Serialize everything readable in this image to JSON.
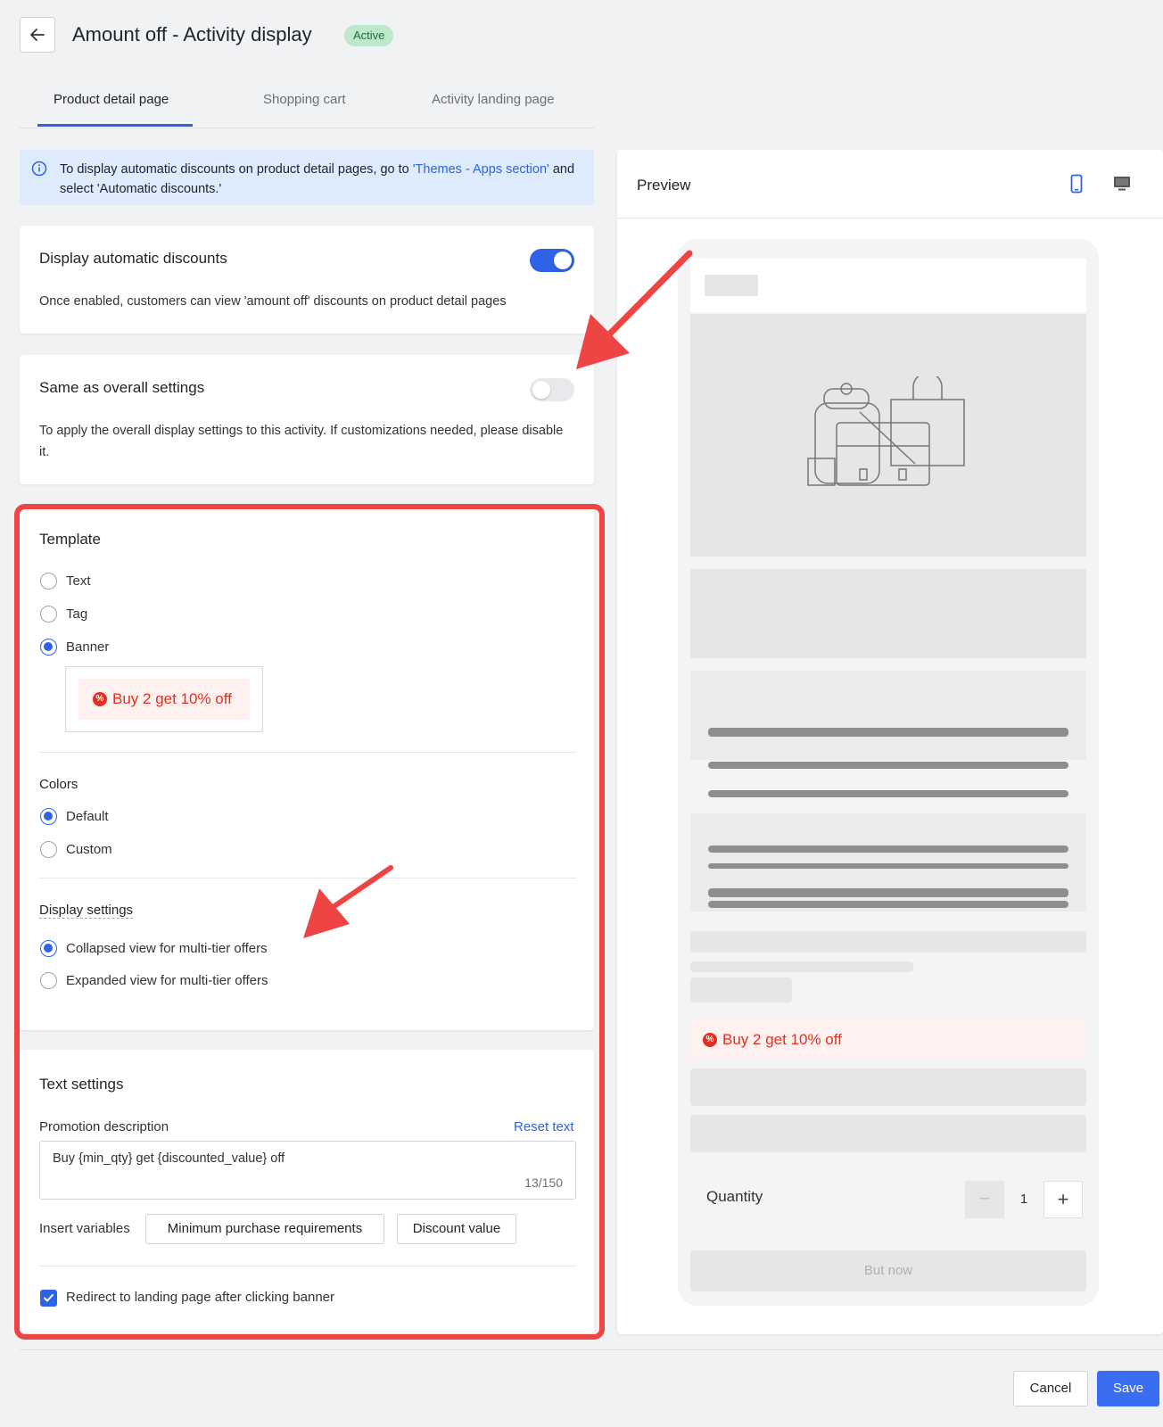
{
  "header": {
    "title": "Amount off - Activity display",
    "status": "Active"
  },
  "tabs": [
    {
      "label": "Product detail page",
      "active": true
    },
    {
      "label": "Shopping cart",
      "active": false
    },
    {
      "label": "Activity landing page",
      "active": false
    }
  ],
  "info_banner": {
    "text_before": "To display automatic discounts on product detail pages, go to ",
    "link_text": "'Themes - Apps section'",
    "text_after": " and select 'Automatic discounts.'"
  },
  "display_automatic": {
    "title": "Display automatic discounts",
    "description": "Once enabled, customers can view 'amount off' discounts on product detail pages",
    "enabled": true
  },
  "same_as_overall": {
    "title": "Same as overall settings",
    "description": "To apply the overall display settings to this activity. If customizations needed, please disable it.",
    "enabled": false
  },
  "template": {
    "title": "Template",
    "options": [
      "Text",
      "Tag",
      "Banner"
    ],
    "selected": "Banner",
    "banner_sample": "Buy 2 get 10% off"
  },
  "colors": {
    "title": "Colors",
    "options": [
      "Default",
      "Custom"
    ],
    "selected": "Default"
  },
  "display_settings": {
    "title": "Display settings",
    "options": [
      "Collapsed view for multi-tier offers",
      "Expanded view for multi-tier offers"
    ],
    "selected": "Collapsed view for multi-tier offers"
  },
  "text_settings": {
    "title": "Text settings",
    "promotion_label": "Promotion description",
    "reset_label": "Reset text",
    "promotion_value": "Buy {min_qty} get {discounted_value} off",
    "char_count": "13/150",
    "insert_label": "Insert variables",
    "variable_buttons": [
      "Minimum purchase requirements",
      "Discount value"
    ],
    "redirect_label": "Redirect to landing page after clicking banner",
    "redirect_checked": true
  },
  "preview": {
    "title": "Preview",
    "banner_text": "Buy 2 get 10% off",
    "quantity_label": "Quantity",
    "quantity_value": "1",
    "buy_button": "But now",
    "icons": [
      "mobile-icon",
      "desktop-icon"
    ]
  },
  "footer": {
    "cancel": "Cancel",
    "save": "Save"
  },
  "colors_palette": {
    "accent": "#2e63e8",
    "highlight_frame": "#ee4444",
    "promo_red": "#e0301e",
    "badge_green": "#bde8cc"
  }
}
